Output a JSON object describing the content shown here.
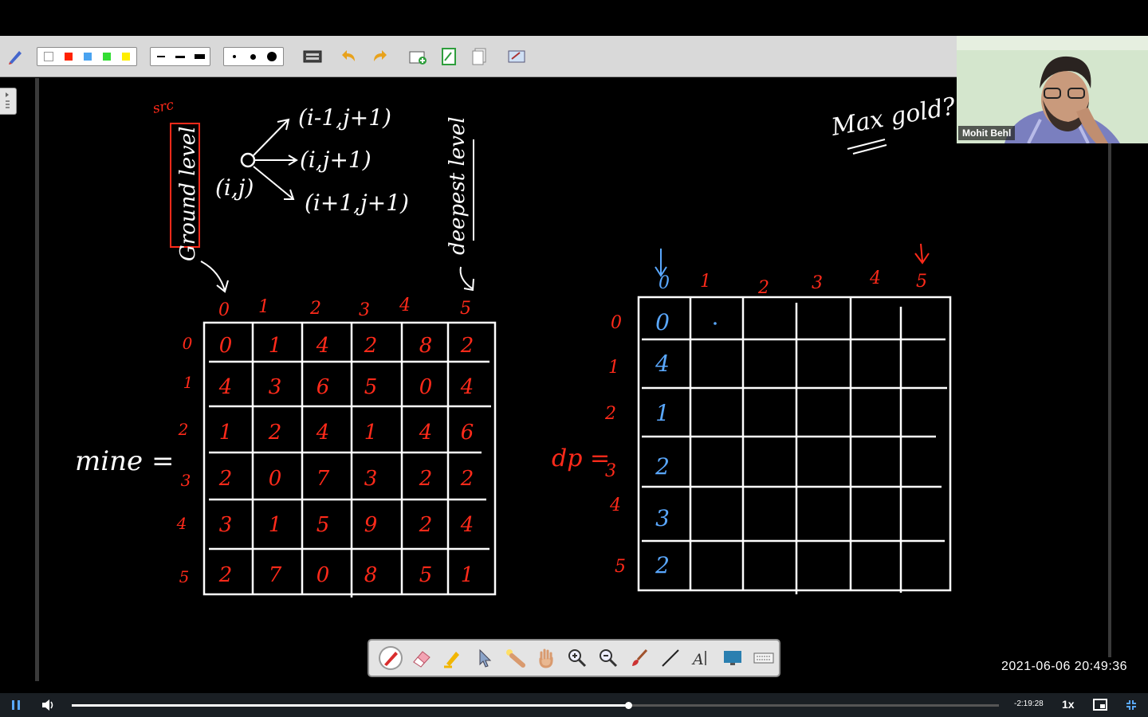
{
  "toolbar": {
    "colors": [
      "#ffffff",
      "#ff2200",
      "#4aa3f0",
      "#33dd33",
      "#ffee00"
    ],
    "line_widths": [
      "thin",
      "medium",
      "thick"
    ],
    "dot_sizes": [
      "small",
      "medium",
      "large"
    ],
    "icons": [
      "pen-settings-icon",
      "keyboard-icon",
      "undo-icon",
      "redo-icon",
      "add-page-icon",
      "page-icon",
      "pages-icon",
      "screenshot-icon"
    ]
  },
  "board": {
    "src_label": "src",
    "ground_label": "Ground level",
    "deepest_label": "deepest level",
    "node_label": "(i,j)",
    "move_up": "(i-1,j+1)",
    "move_right": "(i,j+1)",
    "move_down": "(i+1,j+1)",
    "question": "Max gold?",
    "mine_label": "mine =",
    "dp_label": "dp =",
    "mine_col_headers": [
      "0",
      "1",
      "2",
      "3",
      "4",
      "5"
    ],
    "mine_row_headers": [
      "0",
      "1",
      "2",
      "3",
      "4",
      "5"
    ],
    "mine_grid": [
      [
        "0",
        "1",
        "4",
        "2",
        "8",
        "2"
      ],
      [
        "4",
        "3",
        "6",
        "5",
        "0",
        "4"
      ],
      [
        "1",
        "2",
        "4",
        "1",
        "4",
        "6"
      ],
      [
        "2",
        "0",
        "7",
        "3",
        "2",
        "2"
      ],
      [
        "3",
        "1",
        "5",
        "9",
        "2",
        "4"
      ],
      [
        "2",
        "7",
        "0",
        "8",
        "5",
        "1"
      ]
    ],
    "dp_col_headers": [
      "0",
      "1",
      "2",
      "3",
      "4",
      "5"
    ],
    "dp_row_headers": [
      "0",
      "1",
      "2",
      "3",
      "4",
      "5"
    ],
    "dp_first_col": [
      "0",
      "4",
      "1",
      "2",
      "3",
      "2"
    ]
  },
  "webcam": {
    "presenter_name": "Mohit Behl"
  },
  "drawing_tools": [
    "pen-icon",
    "eraser-icon",
    "highlighter-icon",
    "pointer-icon",
    "laser-pointer-icon",
    "pan-hand-icon",
    "zoom-in-icon",
    "zoom-out-icon",
    "brush-icon",
    "line-icon",
    "text-icon",
    "screen-icon",
    "keyboard-icon"
  ],
  "timestamp": "2021-06-06  20:49:36",
  "player": {
    "remaining": "-2:19:28",
    "speed": "1x",
    "progress": 0.6
  },
  "colors": {
    "chalk_white": "#ffffff",
    "chalk_red": "#ff2a1a",
    "chalk_blue": "#5aa8ff"
  }
}
